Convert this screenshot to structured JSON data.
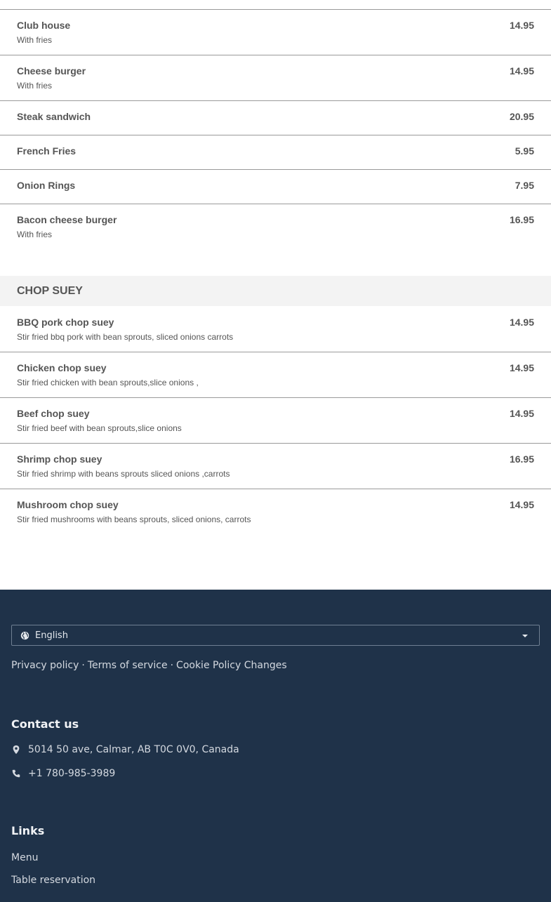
{
  "menu": {
    "items_top": [
      {
        "name": "Club house",
        "price": "14.95",
        "desc": "With fries"
      },
      {
        "name": "Cheese burger",
        "price": "14.95",
        "desc": "With fries"
      },
      {
        "name": "Steak sandwich",
        "price": "20.95",
        "desc": ""
      },
      {
        "name": "French Fries",
        "price": "5.95",
        "desc": ""
      },
      {
        "name": "Onion Rings",
        "price": "7.95",
        "desc": ""
      },
      {
        "name": "Bacon cheese burger",
        "price": "16.95",
        "desc": "With fries"
      }
    ],
    "section": {
      "title": "CHOP SUEY",
      "items": [
        {
          "name": "BBQ pork chop suey",
          "price": "14.95",
          "desc": "Stir fried bbq pork with bean sprouts, sliced onions carrots"
        },
        {
          "name": "Chicken chop suey",
          "price": "14.95",
          "desc": "Stir fried chicken with bean sprouts,slice onions ,"
        },
        {
          "name": "Beef chop suey",
          "price": "14.95",
          "desc": "Stir fried beef with bean sprouts,slice onions"
        },
        {
          "name": "Shrimp chop suey",
          "price": "16.95",
          "desc": "Stir fried shrimp with beans sprouts sliced onions ,carrots"
        },
        {
          "name": "Mushroom chop suey",
          "price": "14.95",
          "desc": "Stir fried mushrooms with beans sprouts, sliced onions, carrots"
        }
      ]
    }
  },
  "footer": {
    "language": {
      "selected": "English",
      "icon": "globe-icon"
    },
    "policy_links": [
      "Privacy policy",
      "Terms of service",
      "Cookie Policy Changes"
    ],
    "separator": "·",
    "contact": {
      "title": "Contact us",
      "address": "5014 50 ave, Calmar, AB T0C 0V0, Canada",
      "phone": "+1 780-985-3989"
    },
    "links": {
      "title": "Links",
      "items": [
        "Menu",
        "Table reservation"
      ]
    }
  },
  "colors": {
    "footer_bg": "#1f3249",
    "section_bg": "#f3f3f3",
    "divider": "#9a9a9a"
  }
}
